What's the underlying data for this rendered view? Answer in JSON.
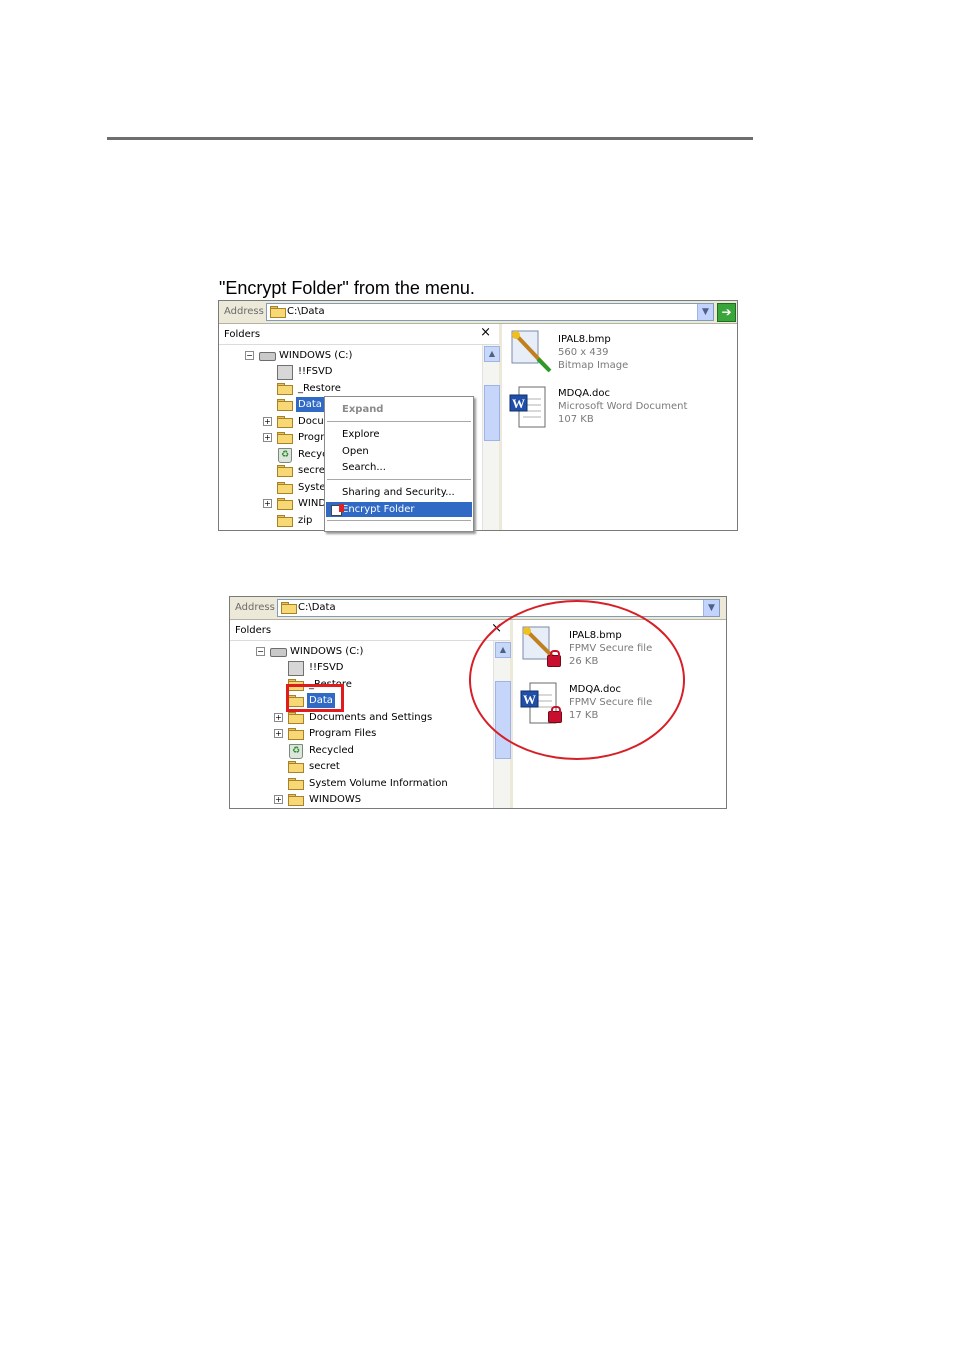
{
  "caption": "\"Encrypt Folder\" from the menu.",
  "screenshot1": {
    "address_label": "Address",
    "address_value": "C:\\Data",
    "go_icon": "go-arrow-icon",
    "folders_title": "Folders",
    "close_label": "×",
    "tree": {
      "root": "WINDOWS (C:)",
      "items": [
        "!!FSVD",
        "_Restore",
        "Data",
        "Docur",
        "Progr",
        "Recyc",
        "secre",
        "Syste",
        "WIND",
        "zip"
      ]
    },
    "context_menu": {
      "expand": "Expand",
      "explore": "Explore",
      "open": "Open",
      "search": "Search...",
      "sharing": "Sharing and Security...",
      "encrypt": "Encrypt Folder"
    },
    "files": [
      {
        "name": "IPAL8.bmp",
        "line2": "560 x 439",
        "line3": "Bitmap Image",
        "icon": "paint-bitmap-icon"
      },
      {
        "name": "MDQA.doc",
        "line2": "Microsoft Word Document",
        "line3": "107 KB",
        "icon": "word-document-icon"
      }
    ]
  },
  "screenshot2": {
    "address_label": "Address",
    "address_value": "C:\\Data",
    "folders_title": "Folders",
    "close_label": "×",
    "tree": {
      "root": "WINDOWS (C:)",
      "items": [
        "!!FSVD",
        "_Restore",
        "Data",
        "Documents and Settings",
        "Program Files",
        "Recycled",
        "secret",
        "System Volume Information",
        "WINDOWS"
      ]
    },
    "files": [
      {
        "name": "IPAL8.bmp",
        "line2": "FPMV Secure file",
        "line3": "26 KB",
        "icon": "locked-bitmap-icon"
      },
      {
        "name": "MDQA.doc",
        "line2": "FPMV Secure file",
        "line3": "17 KB",
        "icon": "locked-word-document-icon"
      }
    ],
    "highlight_colors": {
      "box": "#e01b1b",
      "ellipse": "#d61f26"
    }
  }
}
